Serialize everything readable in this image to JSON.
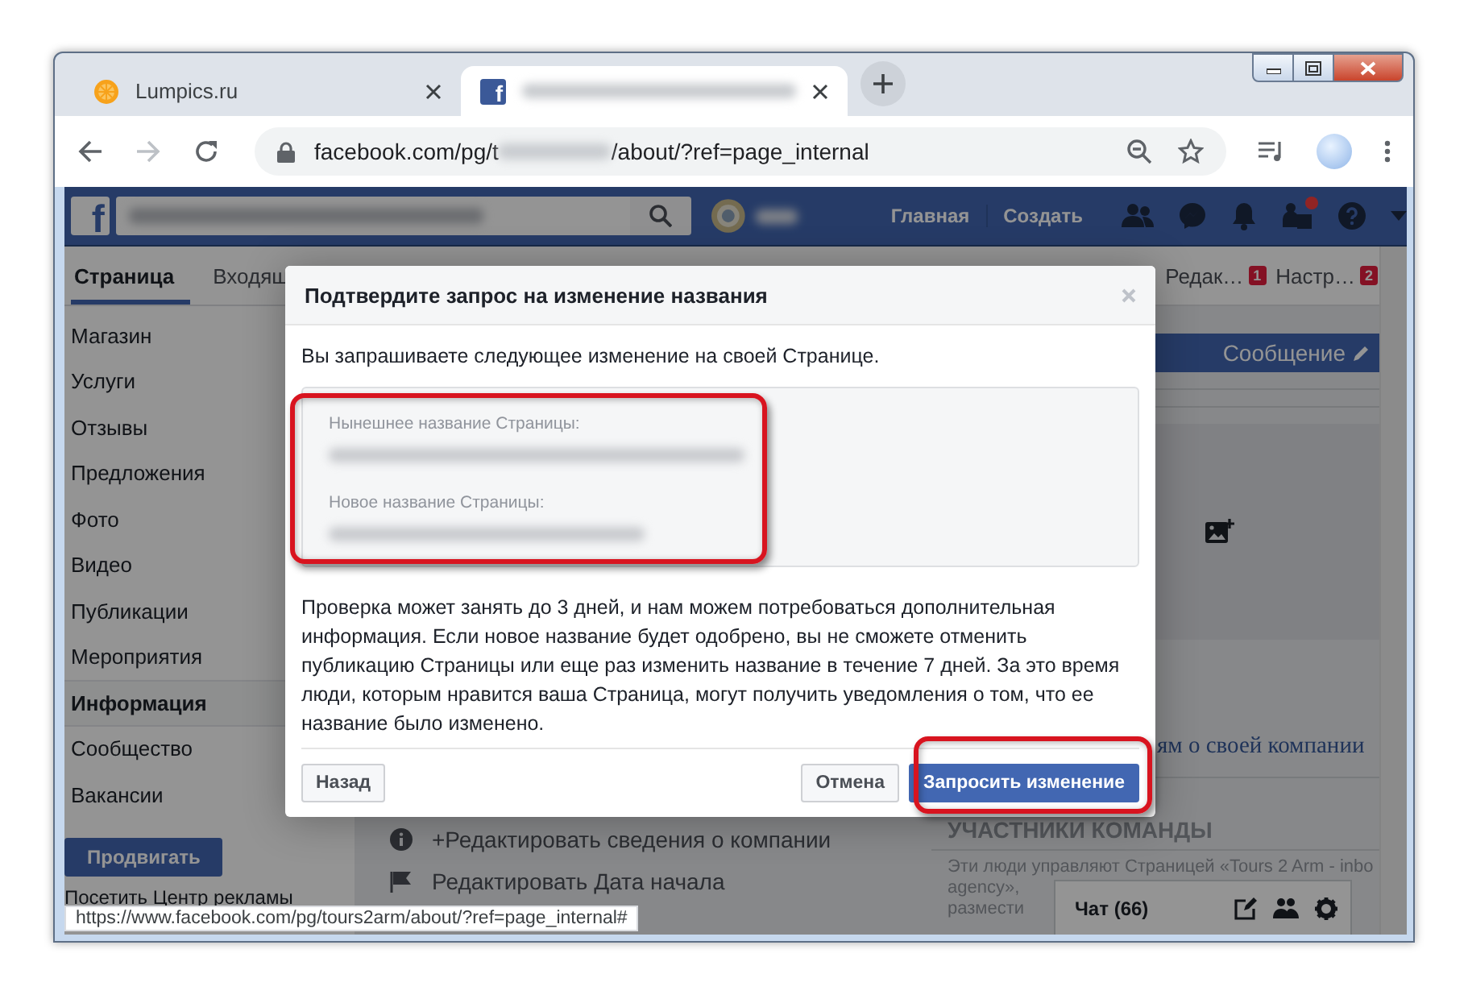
{
  "browser": {
    "tabs": [
      {
        "kind": "site",
        "title": "Lumpics.ru",
        "selected": false
      },
      {
        "kind": "facebook",
        "favicon": "f",
        "selected": true
      }
    ],
    "address": {
      "url_start": "facebook.com/pg/t",
      "url_end": "/about/?ref=page_internal"
    },
    "status_url": "https://www.facebook.com/pg/tours2arm/about/?ref=page_internal#"
  },
  "facebook_bar": {
    "logo": "f",
    "links": [
      "Главная",
      "Создать"
    ]
  },
  "page_tabs": [
    {
      "label": "Страница",
      "selected": true
    },
    {
      "label": "Входящ",
      "selected": false
    }
  ],
  "page_tabs_right": [
    {
      "label": "Редак…",
      "badge": "1"
    },
    {
      "label": "Настр…",
      "badge": "2"
    }
  ],
  "sidebar": {
    "items": [
      {
        "label": "Магазин",
        "selected": false
      },
      {
        "label": "Услуги",
        "selected": false
      },
      {
        "label": "Отзывы",
        "selected": false
      },
      {
        "label": "Предложения",
        "selected": false
      },
      {
        "label": "Фото",
        "selected": false
      },
      {
        "label": "Видео",
        "selected": false
      },
      {
        "label": "Публикации",
        "selected": false
      },
      {
        "label": "Мероприятия",
        "selected": false
      },
      {
        "label": "Информация",
        "selected": true
      },
      {
        "label": "Сообщество",
        "selected": false
      },
      {
        "label": "Вакансии",
        "selected": false
      }
    ],
    "promote_button": "Продвигать",
    "ads_link": "Посетить Центр рекламы"
  },
  "main": {
    "links": [
      {
        "kind": "info",
        "text": "+Редактировать сведения о компании"
      },
      {
        "kind": "flag",
        "text": "Редактировать Дата начала"
      }
    ]
  },
  "right_column": {
    "message_button": "Сообщение",
    "company_link": "ям о своей компании",
    "team_heading": "УЧАСТНИКИ КОМАНДЫ",
    "team_lines": [
      "Эти люди управляют Страницей «Tours 2 Arm - inbo",
      "agency»,",
      "размести"
    ]
  },
  "chat": {
    "label": "Чат (66)"
  },
  "dialog": {
    "title": "Подтвердите запрос на изменение названия",
    "intro": "Вы запрашиваете следующее изменение на своей Странице.",
    "current_label": "Нынешнее название Страницы:",
    "new_label": "Новое название Страницы:",
    "text": "Проверка может занять до 3 дней, и нам можем потребоваться дополнительная информация. Если новое название будет одобрено, вы не сможете отменить публикацию Страницы или еще раз изменить название в течение 7 дней. За это время люди, которым нравится ваша Страница, могут получить уведомления о том, что ее название было изменено.",
    "buttons": [
      {
        "kind": "back",
        "label": "Назад"
      },
      {
        "kind": "secondary",
        "label": "Отмена"
      },
      {
        "kind": "primary",
        "label": "Запросить изменение"
      }
    ]
  }
}
